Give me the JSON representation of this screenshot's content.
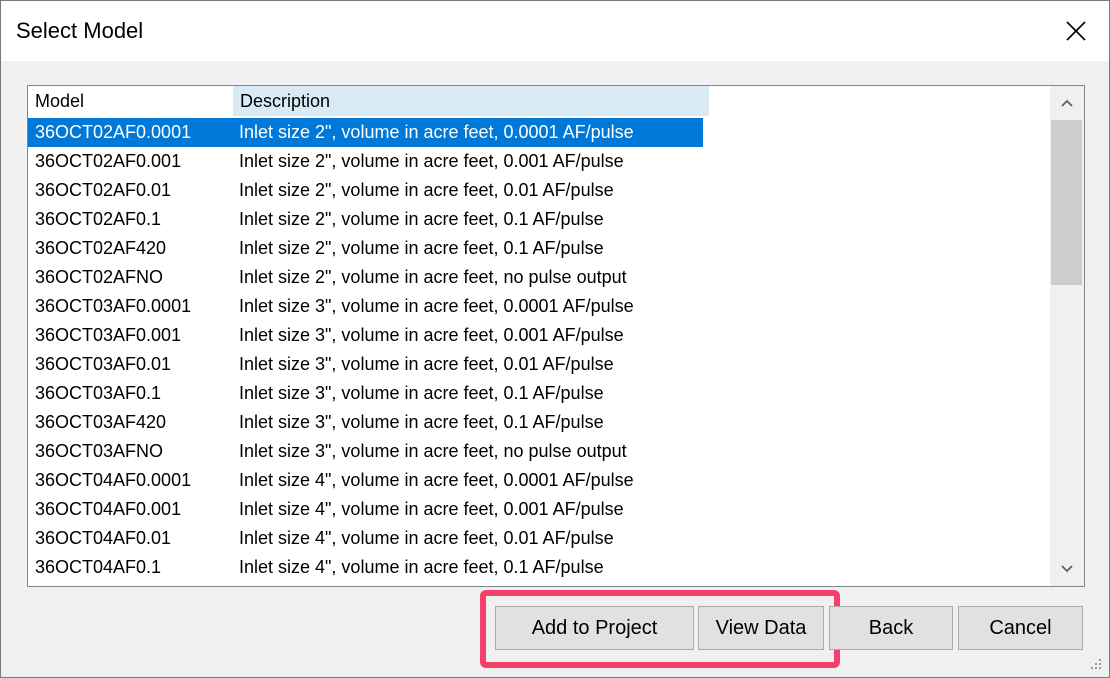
{
  "dialog": {
    "title": "Select Model"
  },
  "icons": {
    "close": "close-icon",
    "scroll_up": "chevron-up-icon",
    "scroll_down": "chevron-down-icon",
    "resize": "resize-grip-icon"
  },
  "colors": {
    "selection": "#0078d7",
    "header_highlight": "#d9eaf7",
    "annotation": "#f2416b"
  },
  "list": {
    "columns": [
      "Model",
      "Description"
    ],
    "selected_index": 0,
    "rows": [
      {
        "model": "36OCT02AF0.0001",
        "description": "Inlet size 2\", volume in acre feet, 0.0001 AF/pulse"
      },
      {
        "model": "36OCT02AF0.001",
        "description": "Inlet size 2\", volume in acre feet, 0.001 AF/pulse"
      },
      {
        "model": "36OCT02AF0.01",
        "description": "Inlet size 2\", volume in acre feet, 0.01 AF/pulse"
      },
      {
        "model": "36OCT02AF0.1",
        "description": "Inlet size 2\", volume in acre feet, 0.1 AF/pulse"
      },
      {
        "model": "36OCT02AF420",
        "description": "Inlet size 2\", volume in acre feet, 0.1 AF/pulse"
      },
      {
        "model": "36OCT02AFNO",
        "description": "Inlet size 2\", volume in acre feet, no pulse output"
      },
      {
        "model": "36OCT03AF0.0001",
        "description": "Inlet size 3\", volume in acre feet, 0.0001 AF/pulse"
      },
      {
        "model": "36OCT03AF0.001",
        "description": "Inlet size 3\", volume in acre feet, 0.001 AF/pulse"
      },
      {
        "model": "36OCT03AF0.01",
        "description": "Inlet size 3\", volume in acre feet, 0.01 AF/pulse"
      },
      {
        "model": "36OCT03AF0.1",
        "description": "Inlet size 3\", volume in acre feet, 0.1 AF/pulse"
      },
      {
        "model": "36OCT03AF420",
        "description": "Inlet size 3\", volume in acre feet, 0.1 AF/pulse"
      },
      {
        "model": "36OCT03AFNO",
        "description": "Inlet size 3\", volume in acre feet, no pulse output"
      },
      {
        "model": "36OCT04AF0.0001",
        "description": "Inlet size 4\", volume in acre feet, 0.0001 AF/pulse"
      },
      {
        "model": "36OCT04AF0.001",
        "description": "Inlet size 4\", volume in acre feet, 0.001 AF/pulse"
      },
      {
        "model": "36OCT04AF0.01",
        "description": "Inlet size 4\", volume in acre feet, 0.01 AF/pulse"
      },
      {
        "model": "36OCT04AF0.1",
        "description": "Inlet size 4\", volume in acre feet, 0.1 AF/pulse"
      }
    ]
  },
  "buttons": {
    "add_to_project": "Add to Project",
    "view_data": "View Data",
    "back": "Back",
    "cancel": "Cancel"
  }
}
